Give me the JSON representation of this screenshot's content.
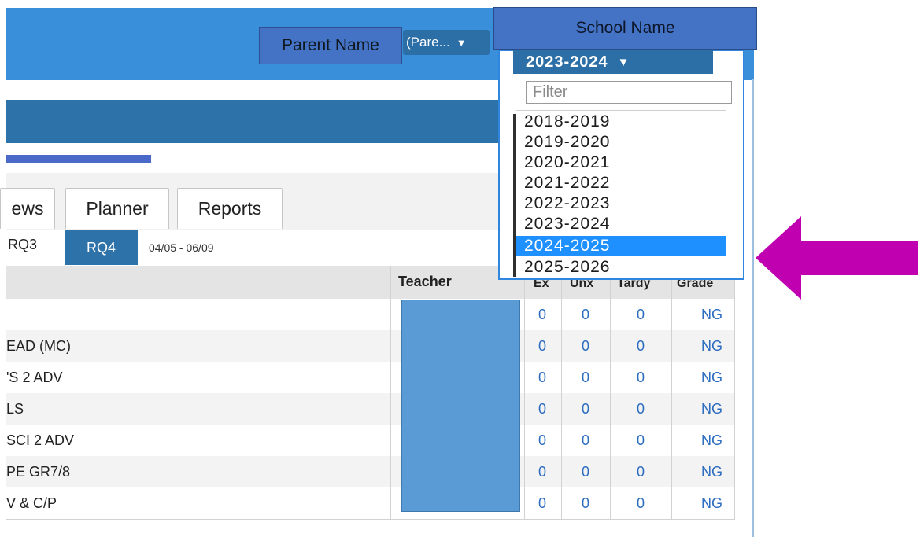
{
  "header": {
    "parent_label": "Parent Name",
    "parent_select_label": "(Pare...",
    "school_label": "School Name"
  },
  "year_dropdown": {
    "selected": "2023-2024",
    "filter_placeholder": "Filter",
    "options": [
      "2018-2019",
      "2019-2020",
      "2020-2021",
      "2021-2022",
      "2022-2023",
      "2023-2024",
      "2024-2025",
      "2025-2026"
    ],
    "highlighted": "2024-2025",
    "highlight_color": "#1e90ff"
  },
  "tabs": [
    {
      "label": "ews"
    },
    {
      "label": "Planner"
    },
    {
      "label": "Reports"
    }
  ],
  "terms": {
    "rq3": "RQ3",
    "rq4": "RQ4",
    "date_range": "04/05 - 06/09"
  },
  "table": {
    "headers": {
      "teacher": "Teacher",
      "ex": "Ex",
      "unx": "Unx",
      "tardy": "Tardy",
      "grade": "Grade"
    },
    "rows": [
      {
        "course": "",
        "ex": "0",
        "unx": "0",
        "tardy": "0",
        "grade": "NG"
      },
      {
        "course": "EAD (MC)",
        "ex": "0",
        "unx": "0",
        "tardy": "0",
        "grade": "NG"
      },
      {
        "course": "'S 2 ADV",
        "ex": "0",
        "unx": "0",
        "tardy": "0",
        "grade": "NG"
      },
      {
        "course": "LS",
        "ex": "0",
        "unx": "0",
        "tardy": "0",
        "grade": "NG"
      },
      {
        "course": "SCI 2 ADV",
        "ex": "0",
        "unx": "0",
        "tardy": "0",
        "grade": "NG"
      },
      {
        "course": "PE GR7/8",
        "ex": "0",
        "unx": "0",
        "tardy": "0",
        "grade": "NG"
      },
      {
        "course": "V & C/P",
        "ex": "0",
        "unx": "0",
        "tardy": "0",
        "grade": "NG"
      }
    ]
  },
  "colors": {
    "header_blue": "#3a8fdb",
    "accent_blue": "#2e72aa",
    "annotation_box": "#4472c4",
    "arrow": "#c000b0",
    "link_blue": "#2a6bbf"
  },
  "icons": {
    "dropdown_caret": "caret-down-icon",
    "annotation_arrow": "arrow-left-icon"
  }
}
